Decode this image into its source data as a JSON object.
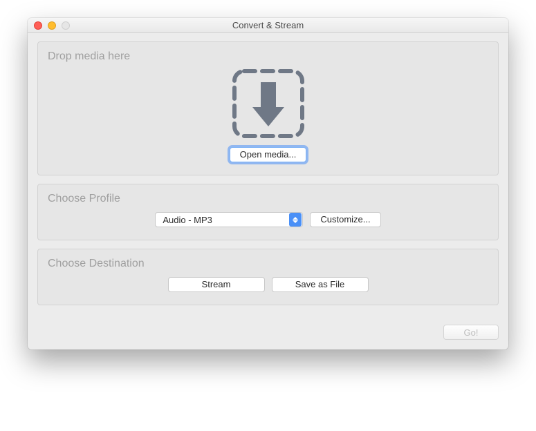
{
  "window": {
    "title": "Convert & Stream"
  },
  "drop": {
    "title": "Drop media here",
    "open_button": "Open media..."
  },
  "profile": {
    "title": "Choose Profile",
    "selected": "Audio - MP3",
    "customize_button": "Customize..."
  },
  "destination": {
    "title": "Choose Destination",
    "stream_button": "Stream",
    "save_button": "Save as File"
  },
  "footer": {
    "go_button": "Go!"
  }
}
